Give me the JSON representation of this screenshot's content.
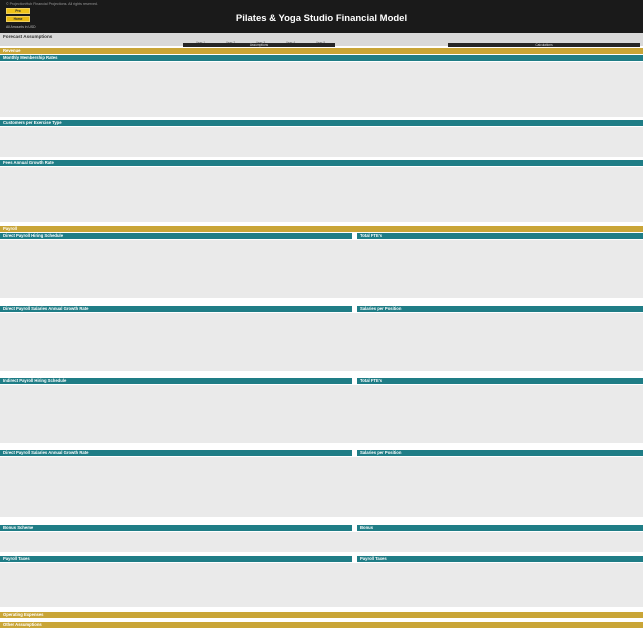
{
  "header": {
    "copyright": "© ProjectionHub Financial Projections. All rights reserved.",
    "btn_primary": "Pro",
    "btn_secondary": "Home",
    "title": "Pilates & Yoga Studio Financial Model",
    "subtitle": "All Amounts in USD"
  },
  "strip": {
    "label": "Forecast Assumptions",
    "year_headers": [
      "Year 1",
      "Year 2",
      "Year 3",
      "Year 4",
      "Year 5"
    ],
    "assumptions_tab": "Assumptions",
    "calculations_tab": "Calculations"
  },
  "sections": {
    "revenue": "Revenue",
    "payroll": "Payroll",
    "opex": "Operating Expenses",
    "other": "Other Assumptions"
  },
  "subsections": {
    "membership_rates": "Monthly Membership Rates",
    "customers_by_type": "Customers per Exercise Type",
    "annual_growth": "Fees Annual Growth Rate",
    "direct_hiring": "Direct Payroll Hiring Schedule",
    "direct_fte": "Total FTE's",
    "direct_salary_growth": "Direct Payroll Salaries Annual Growth Rate",
    "direct_salary_calc": "Salaries per Position",
    "indirect_hiring": "Indirect Payroll Hiring Schedule",
    "indirect_fte": "Total FTE's",
    "indirect_salary_growth": "Direct Payroll Salaries Annual Growth Rate",
    "indirect_salary_calc": "Salaries per Position",
    "bonus": "Bonus Scheme",
    "bonus_calc": "Bonus",
    "payroll_taxes": "Payroll Taxes",
    "payroll_taxes_calc": "Payroll Taxes"
  }
}
